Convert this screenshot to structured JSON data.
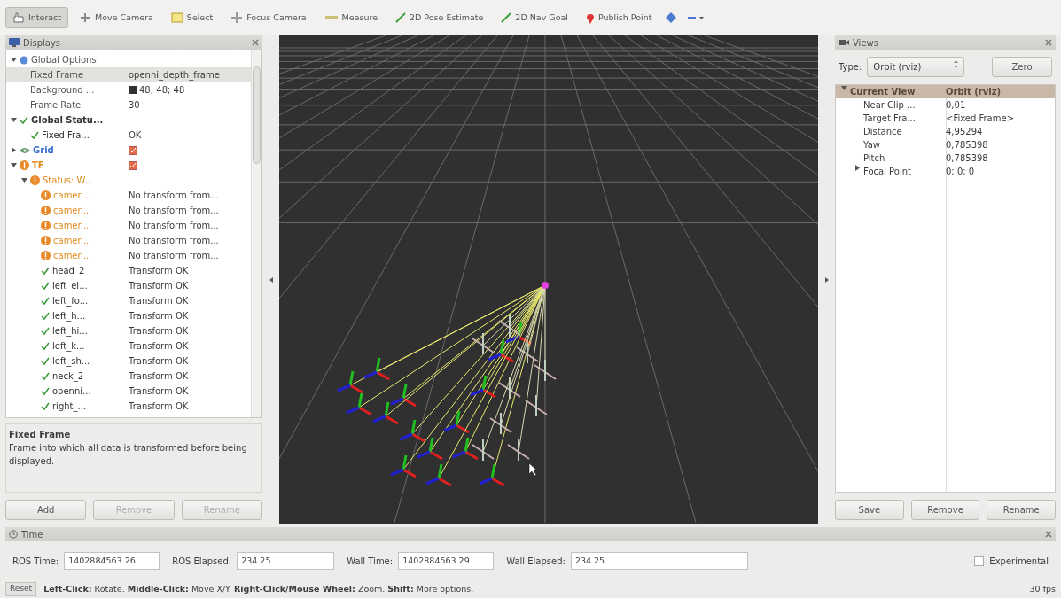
{
  "toolbar": [
    {
      "label": "Interact",
      "kind": "interact",
      "selected": true
    },
    {
      "label": "Move Camera",
      "kind": "move",
      "selected": false
    },
    {
      "label": "Select",
      "kind": "select",
      "selected": false
    },
    {
      "label": "Focus Camera",
      "kind": "focus",
      "selected": false
    },
    {
      "label": "Measure",
      "kind": "measure",
      "selected": false
    },
    {
      "label": "2D Pose Estimate",
      "kind": "pose",
      "selected": false
    },
    {
      "label": "2D Nav Goal",
      "kind": "pose",
      "selected": false
    },
    {
      "label": "Publish Point",
      "kind": "pin",
      "selected": false
    },
    {
      "kind": "diamond",
      "selected": false
    },
    {
      "kind": "more",
      "selected": false
    }
  ],
  "displays": {
    "title": "Displays",
    "tree": [
      {
        "name": "Global Options",
        "kind": "global",
        "expanded": true,
        "children": [
          {
            "name": "Fixed Frame",
            "value": "openni_depth_frame",
            "kind": "plain",
            "selected": true
          },
          {
            "name": "Background ...",
            "value": "48; 48; 48",
            "color": "#303030",
            "kind": "plain",
            "selected": false
          },
          {
            "name": "Frame Rate",
            "value": "30",
            "kind": "plain",
            "selected": false
          }
        ]
      },
      {
        "name": "Global Statu...",
        "kind": "ok",
        "expanded": true,
        "children": [
          {
            "name": "Fixed Fra...",
            "value": "OK",
            "kind": "ok",
            "selected": false
          }
        ]
      },
      {
        "name": "Grid",
        "kind": "display",
        "expanded": false,
        "checked": true
      },
      {
        "name": "TF",
        "kind": "warn",
        "expanded": true,
        "checked": true,
        "children": [
          {
            "name": "Status: W...",
            "kind": "warn",
            "expanded": true,
            "children": [
              {
                "name": "camer...",
                "value": "No transform from...",
                "kind": "warn",
                "selected": false
              },
              {
                "name": "camer...",
                "value": "No transform from...",
                "kind": "warn",
                "selected": false
              },
              {
                "name": "camer...",
                "value": "No transform from...",
                "kind": "warn",
                "selected": false
              },
              {
                "name": "camer...",
                "value": "No transform from...",
                "kind": "warn",
                "selected": false
              },
              {
                "name": "camer...",
                "value": "No transform from...",
                "kind": "warn",
                "selected": false
              },
              {
                "name": "head_2",
                "value": "Transform OK",
                "kind": "ok",
                "selected": false
              },
              {
                "name": "left_el...",
                "value": "Transform OK",
                "kind": "ok",
                "selected": false
              },
              {
                "name": "left_fo...",
                "value": "Transform OK",
                "kind": "ok",
                "selected": false
              },
              {
                "name": "left_h...",
                "value": "Transform OK",
                "kind": "ok",
                "selected": false
              },
              {
                "name": "left_hi...",
                "value": "Transform OK",
                "kind": "ok",
                "selected": false
              },
              {
                "name": "left_k...",
                "value": "Transform OK",
                "kind": "ok",
                "selected": false
              },
              {
                "name": "left_sh...",
                "value": "Transform OK",
                "kind": "ok",
                "selected": false
              },
              {
                "name": "neck_2",
                "value": "Transform OK",
                "kind": "ok",
                "selected": false
              },
              {
                "name": "openni...",
                "value": "Transform OK",
                "kind": "ok",
                "selected": false
              },
              {
                "name": "right_...",
                "value": "Transform OK",
                "kind": "ok",
                "selected": false
              }
            ]
          }
        ]
      }
    ],
    "description": {
      "title": "Fixed Frame",
      "text": "Frame into which all data is transformed before being displayed."
    },
    "buttons": [
      {
        "label": "Add",
        "disabled": false
      },
      {
        "label": "Remove",
        "disabled": true
      },
      {
        "label": "Rename",
        "disabled": true
      }
    ]
  },
  "views": {
    "title": "Views",
    "type_label": "Type:",
    "type_value": "Orbit (rviz)",
    "zero_button": "Zero",
    "header": {
      "name": "Current View",
      "value": "Orbit (rviz)",
      "expanded": true
    },
    "properties": [
      {
        "name": "Near Clip ...",
        "value": "0,01"
      },
      {
        "name": "Target Fra...",
        "value": "<Fixed Frame>"
      },
      {
        "name": "Distance",
        "value": "4,95294"
      },
      {
        "name": "Yaw",
        "value": "0,785398"
      },
      {
        "name": "Pitch",
        "value": "0,785398"
      },
      {
        "name": "Focal Point",
        "value": "0; 0; 0",
        "expanded": false
      }
    ],
    "buttons": [
      "Save",
      "Remove",
      "Rename"
    ]
  },
  "time": {
    "title": "Time",
    "fields": [
      {
        "label": "ROS Time:",
        "value": "1402884563.26"
      },
      {
        "label": "ROS Elapsed:",
        "value": "234.25"
      },
      {
        "label": "Wall Time:",
        "value": "1402884563.29"
      },
      {
        "label": "Wall Elapsed:",
        "value": "234.25"
      }
    ],
    "experimental": {
      "label": "Experimental",
      "checked": false
    }
  },
  "status_bar": {
    "reset": "Reset",
    "hint": "**Left-Click:** Rotate. **Middle-Click:** Move X/Y. **Right-Click/Mouse Wheel:** Zoom. **Shift:** More options.",
    "fps": "30 fps"
  }
}
